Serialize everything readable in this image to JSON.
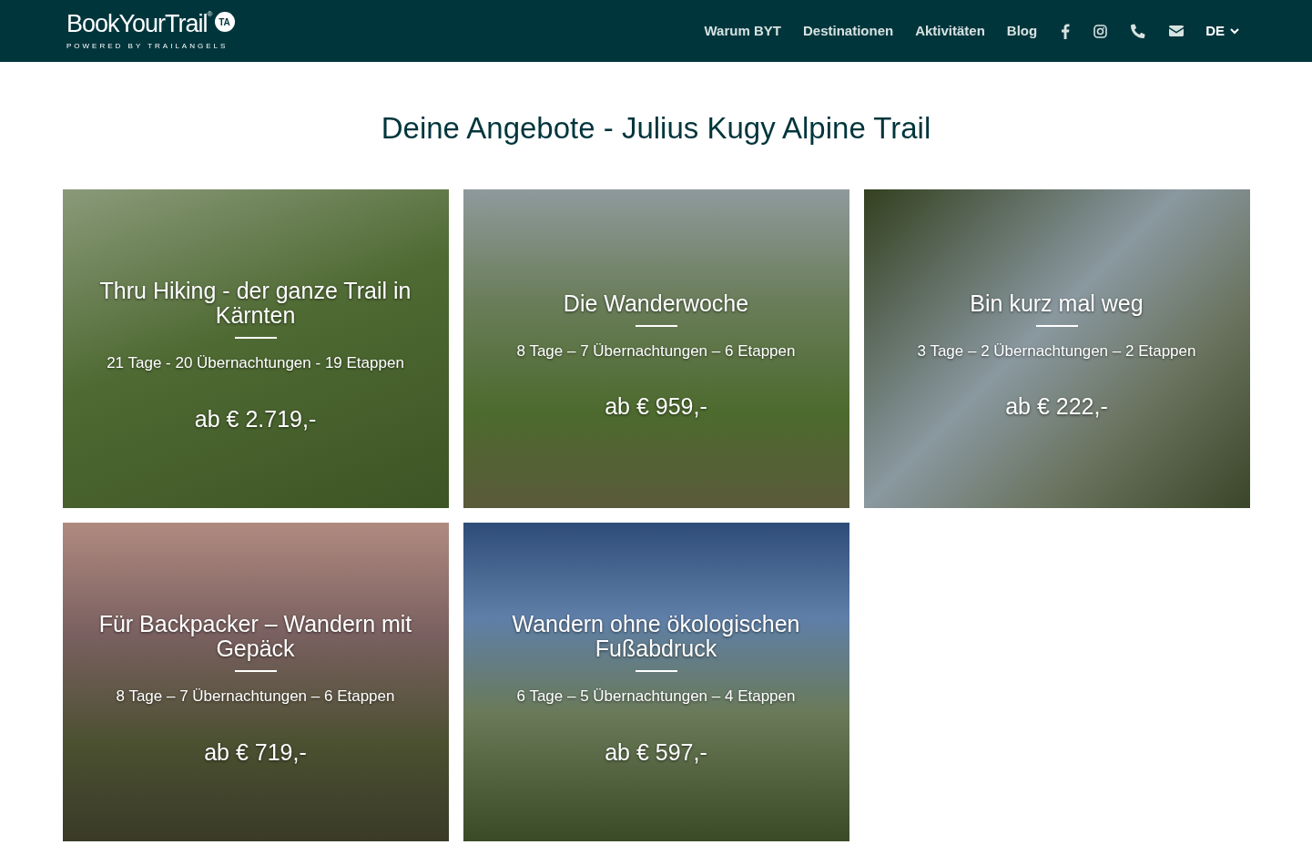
{
  "header": {
    "logo": {
      "name": "BookYourTrail",
      "mark": "®",
      "badge": "TA",
      "tagline": "POWERED BY TRAILANGELS"
    },
    "nav": [
      {
        "label": "Warum BYT"
      },
      {
        "label": "Destinationen"
      },
      {
        "label": "Aktivitäten"
      },
      {
        "label": "Blog"
      }
    ],
    "icons": [
      {
        "kind": "facebook"
      },
      {
        "kind": "instagram"
      },
      {
        "kind": "phone"
      },
      {
        "kind": "mail"
      }
    ],
    "language": "DE"
  },
  "title": "Deine Angebote - Julius Kugy Alpine Trail",
  "offers": [
    {
      "title": "Thru Hiking - der ganze Trail in Kärnten",
      "details": "21 Tage - 20 Übernachtungen - 19 Etappen",
      "price": "ab € 2.719,-"
    },
    {
      "title": "Die Wanderwoche",
      "details": "8 Tage – 7 Übernachtungen – 6 Etappen",
      "price": "ab € 959,-"
    },
    {
      "title": "Bin kurz mal weg",
      "details": "3 Tage – 2 Übernachtungen – 2 Etappen",
      "price": "ab € 222,-"
    },
    {
      "title": "Für Backpacker – Wandern mit Gepäck",
      "details": "8 Tage – 7 Übernachtungen – 6 Etappen",
      "price": "ab € 719,-"
    },
    {
      "title": "Wandern ohne ökologischen Fußabdruck",
      "details": "6 Tage – 5 Übernachtungen – 4 Etappen",
      "price": "ab € 597,-"
    }
  ]
}
